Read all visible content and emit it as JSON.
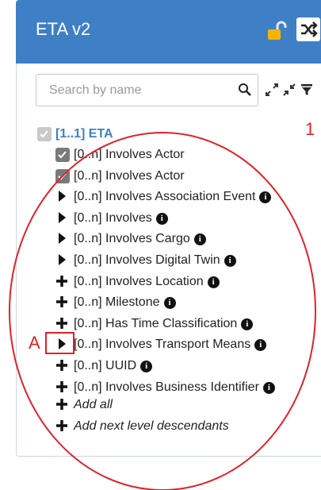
{
  "header": {
    "title": "ETA v2"
  },
  "colors": {
    "header_bg": "#3f7fc6",
    "annotation": "#e0222a",
    "root_link": "#3f7fc6"
  },
  "search": {
    "placeholder": "Search by name"
  },
  "icons": {
    "lock": "unlocked-padlock-icon",
    "shuffle": "shuffle-icon",
    "search": "search-icon",
    "expand": "expand-icon",
    "collapse": "collapse-icon",
    "filter": "filter-icon"
  },
  "tree": {
    "root": "[1..1] ETA",
    "items": [
      {
        "label": "[0..n] Involves Actor",
        "kind": "checked",
        "info": false
      },
      {
        "label": "[0..n] Involves Actor",
        "kind": "checked",
        "info": false
      },
      {
        "label": "[0..n] Involves Association Event",
        "kind": "expand",
        "info": true
      },
      {
        "label": "[0..n] Involves",
        "kind": "expand",
        "info": true
      },
      {
        "label": "[0..n] Involves Cargo",
        "kind": "expand",
        "info": true
      },
      {
        "label": "[0..n] Involves Digital Twin",
        "kind": "expand",
        "info": true
      },
      {
        "label": "[0..n] Involves Location",
        "kind": "add",
        "info": true
      },
      {
        "label": "[0..n] Milestone",
        "kind": "add",
        "info": true
      },
      {
        "label": "[0..n] Has Time Classification",
        "kind": "add",
        "info": true
      },
      {
        "label": "[0..n] Involves Transport Means",
        "kind": "expand",
        "info": true
      },
      {
        "label": "[0..n] UUID",
        "kind": "add",
        "info": true
      },
      {
        "label": "[0..n] Involves Business Identifier",
        "kind": "add",
        "info": true
      }
    ],
    "add_all": "Add all",
    "add_next_level": "Add next level descendants",
    "info_glyph": "i"
  },
  "annotations": {
    "label_1": "1",
    "label_a": "A"
  }
}
